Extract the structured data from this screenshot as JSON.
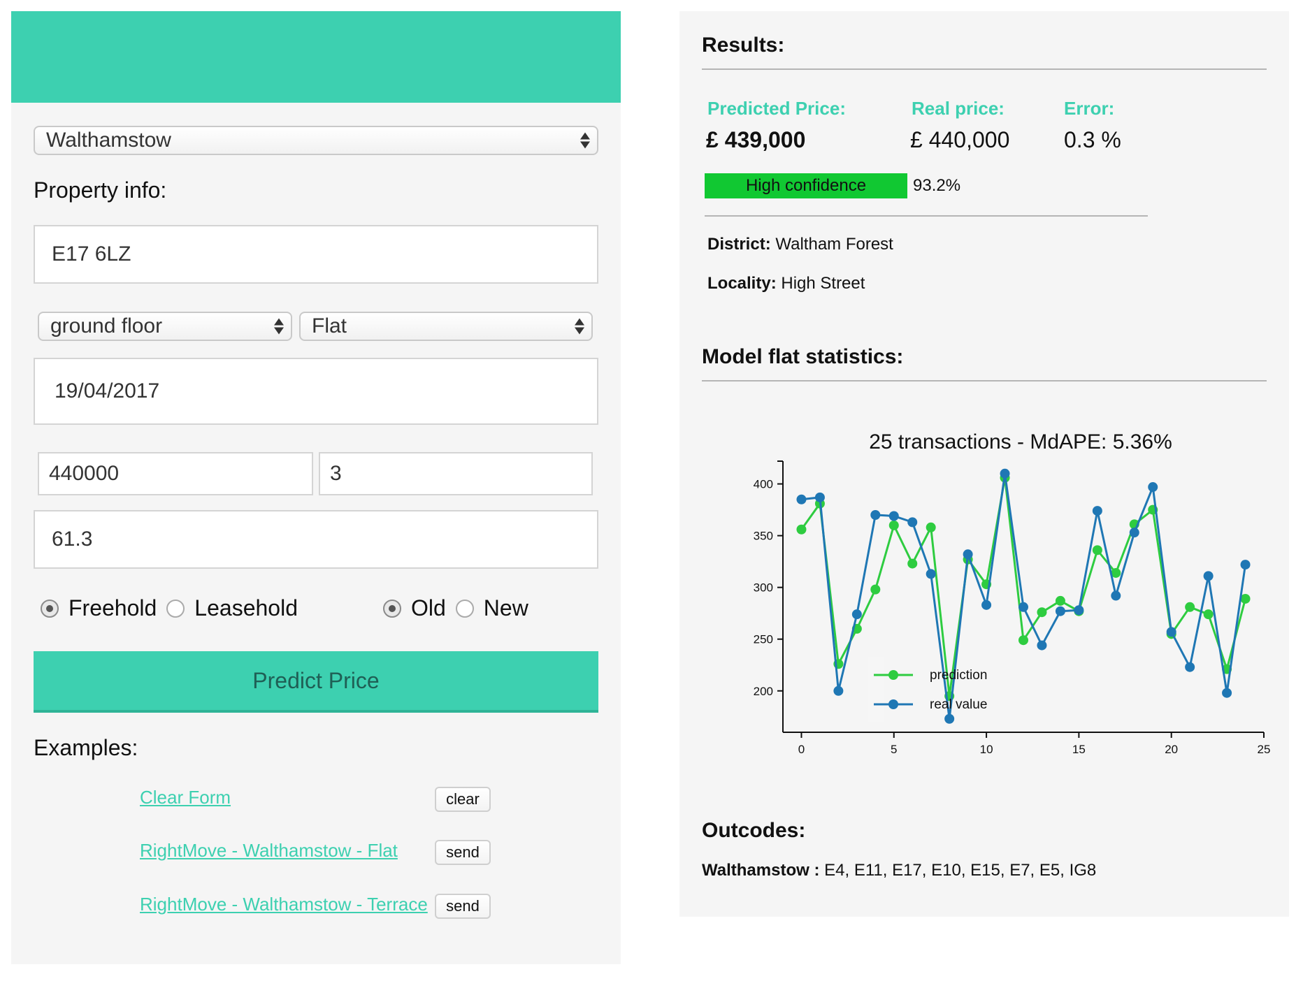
{
  "form": {
    "area_select": "Walthamstow",
    "property_info_label": "Property info:",
    "postcode": "E17 6LZ",
    "floor_select": "ground floor",
    "type_select": "Flat",
    "date": "19/04/2017",
    "price": "440000",
    "rooms": "3",
    "size": "61.3",
    "tenure_options": [
      "Freehold",
      "Leasehold"
    ],
    "tenure_selected": "Freehold",
    "age_options": [
      "Old",
      "New"
    ],
    "age_selected": "Old",
    "predict_label": "Predict Price"
  },
  "examples": {
    "label": "Examples:",
    "items": [
      {
        "link": "Clear Form",
        "button": "clear"
      },
      {
        "link": "RightMove - Walthamstow - Flat",
        "button": "send"
      },
      {
        "link": "RightMove - Walthamstow - Terrace",
        "button": "send"
      }
    ]
  },
  "results": {
    "title": "Results:",
    "predicted_label": "Predicted Price:",
    "predicted_value": "£ 439,000",
    "real_label": "Real price:",
    "real_value": "£ 440,000",
    "error_label": "Error:",
    "error_value": "0.3 %",
    "confidence_label": "High confidence",
    "confidence_pct": "93.2%",
    "confidence_fraction": 0.932,
    "confidence_color": "#11c832",
    "district_label": "District:",
    "district_value": "Waltham Forest",
    "locality_label": "Locality:",
    "locality_value": "High Street"
  },
  "stats": {
    "title": "Model flat statistics:"
  },
  "outcodes": {
    "title": "Outcodes:",
    "area_label": "Walthamstow :",
    "list": "E4, E11, E17, E10, E15, E7, E5, IG8"
  },
  "colors": {
    "accent": "#3dd0b0",
    "prediction": "#2ecc40",
    "real_value": "#1f77b4"
  },
  "chart_data": {
    "type": "line",
    "title": "25 transactions - MdAPE: 5.36%",
    "x": [
      0,
      1,
      2,
      3,
      4,
      5,
      6,
      7,
      8,
      9,
      10,
      11,
      12,
      13,
      14,
      15,
      16,
      17,
      18,
      19,
      20,
      21,
      22,
      23,
      24
    ],
    "xlim": [
      -1,
      25
    ],
    "ylim": [
      160,
      422
    ],
    "xticks": [
      0,
      5,
      10,
      15,
      20,
      25
    ],
    "yticks": [
      200,
      250,
      300,
      350,
      400
    ],
    "legend_position": "bottom-left",
    "series": [
      {
        "name": "prediction",
        "color": "#2ecc40",
        "values": [
          356,
          381,
          226,
          260,
          298,
          360,
          323,
          358,
          195,
          327,
          303,
          406,
          249,
          276,
          287,
          277,
          336,
          314,
          361,
          375,
          255,
          281,
          274,
          221,
          289
        ]
      },
      {
        "name": "real value",
        "color": "#1f77b4",
        "values": [
          385,
          387,
          200,
          274,
          370,
          369,
          363,
          313,
          173,
          332,
          283,
          410,
          281,
          244,
          277,
          278,
          374,
          292,
          353,
          397,
          257,
          223,
          311,
          198,
          322
        ]
      }
    ]
  }
}
